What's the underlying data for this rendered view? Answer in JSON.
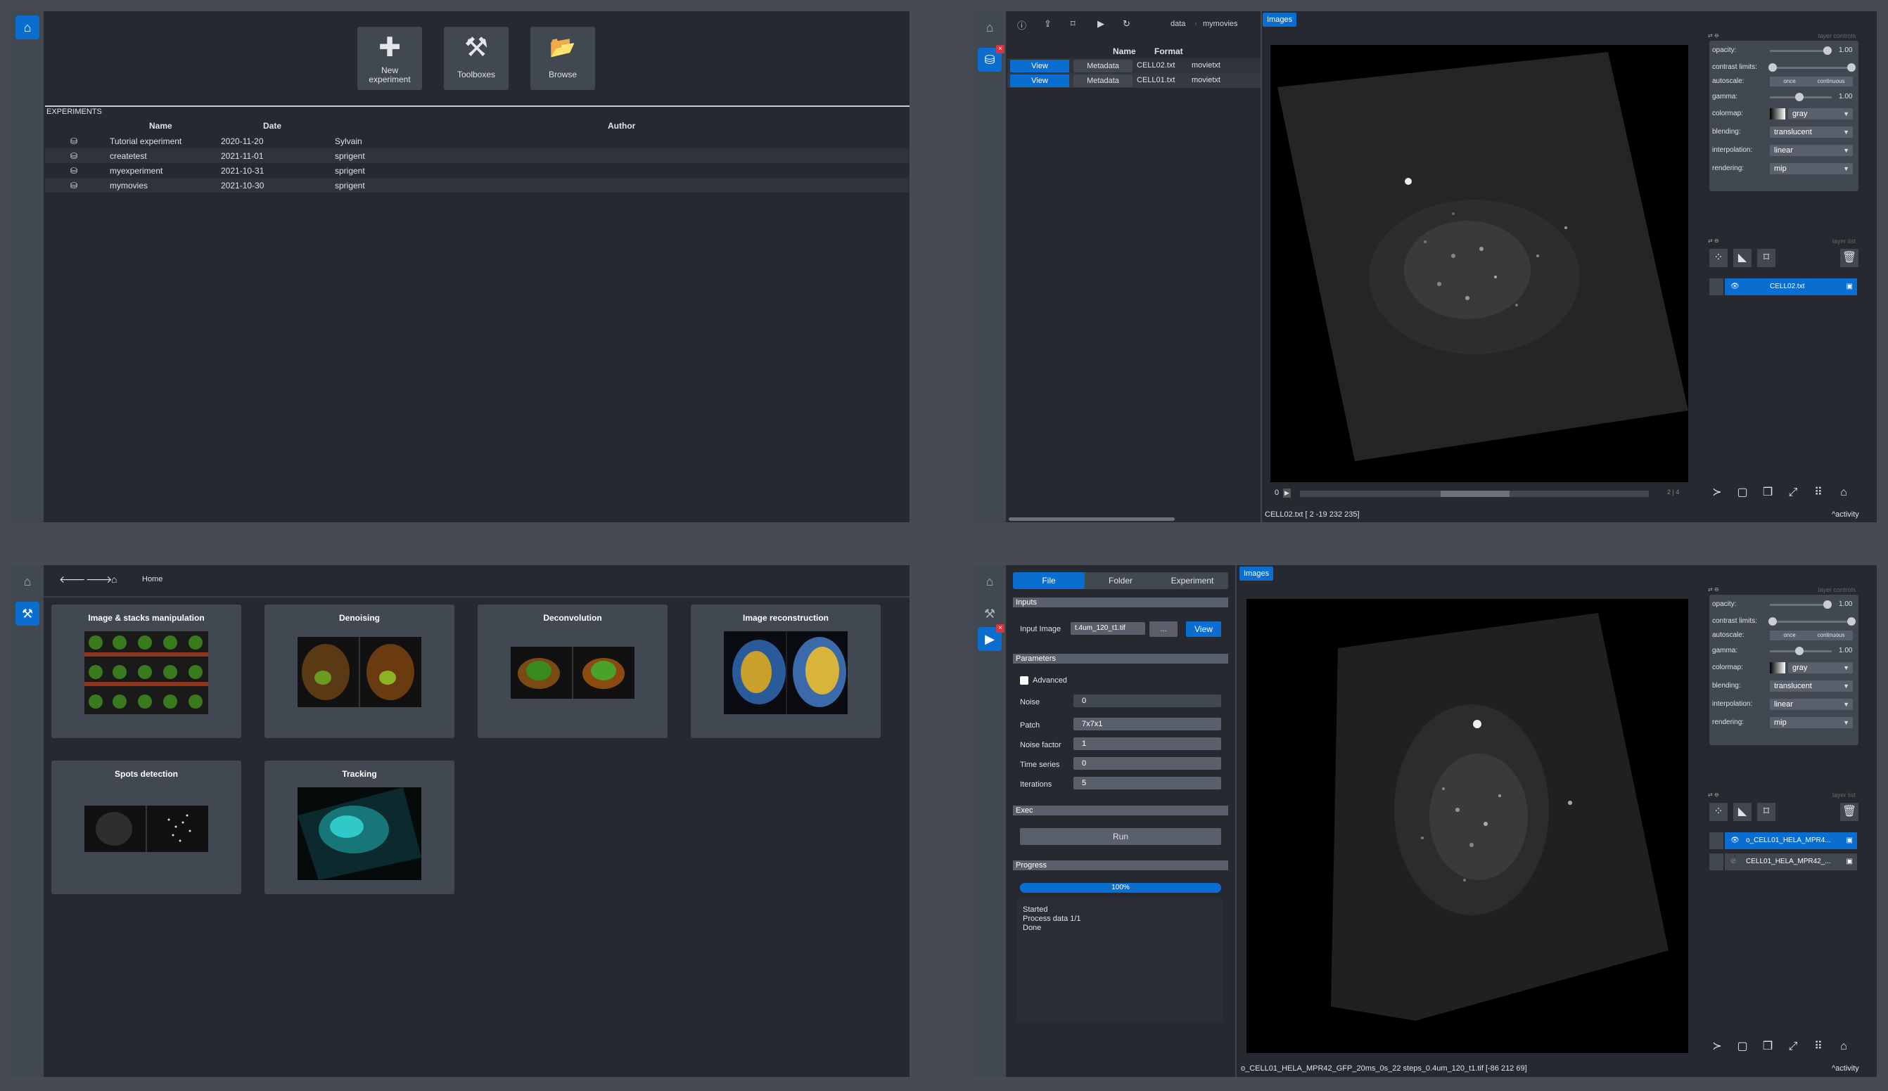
{
  "p1": {
    "tools": [
      {
        "icon": "plus-icon",
        "glyph": "✚",
        "label": "New experiment"
      },
      {
        "icon": "tools-icon",
        "glyph": "⚒",
        "label": "Toolboxes"
      },
      {
        "icon": "folder-open-icon",
        "glyph": "📂",
        "label": "Browse"
      }
    ],
    "section_title": "EXPERIMENTS",
    "columns": [
      "Name",
      "Date",
      "Author"
    ],
    "rows": [
      {
        "name": "Tutorial experiment",
        "date": "2020-11-20",
        "author": "Sylvain"
      },
      {
        "name": "createtest",
        "date": "2021-11-01",
        "author": "sprigent"
      },
      {
        "name": "myexperiment",
        "date": "2021-10-31",
        "author": "sprigent"
      },
      {
        "name": "mymovies",
        "date": "2021-10-30",
        "author": "sprigent"
      }
    ]
  },
  "p2": {
    "breadcrumb": [
      "data",
      "mymovies"
    ],
    "tab": "Images",
    "columns": [
      "Name",
      "Format"
    ],
    "rows": [
      {
        "view": "View",
        "meta": "Metadata",
        "name": "CELL02.txt",
        "format": "movietxt"
      },
      {
        "view": "View",
        "meta": "Metadata",
        "name": "CELL01.txt",
        "format": "movietxt"
      }
    ],
    "status": "CELL02.txt [  2 -19 232 235]",
    "frame": "0",
    "slice": "2 | 4",
    "activity": "activity",
    "layer": "CELL02.txt"
  },
  "p3": {
    "breadcrumb": "Home",
    "cards": [
      "Image & stacks manipulation",
      "Denoising",
      "Deconvolution",
      "Image reconstruction",
      "Spots detection",
      "Tracking"
    ]
  },
  "p4": {
    "tabs": [
      "File",
      "Folder",
      "Experiment"
    ],
    "inputs_title": "Inputs",
    "input_label": "Input Image",
    "input_value": "t.4um_120_t1.tif",
    "browse": "...",
    "view": "View",
    "params_title": "Parameters",
    "advanced": "Advanced",
    "params": [
      {
        "label": "Noise",
        "value": "0"
      },
      {
        "label": "Patch",
        "value": "7x7x1"
      },
      {
        "label": "Noise factor",
        "value": "1"
      },
      {
        "label": "Time series",
        "value": "0"
      },
      {
        "label": "Iterations",
        "value": "5"
      }
    ],
    "exec_title": "Exec",
    "run": "Run",
    "progress_title": "Progress",
    "progress_value": 1.0,
    "progress_text": "100%",
    "log": [
      "Started",
      "Process data 1/1",
      "Done"
    ],
    "tab": "Images",
    "status": "o_CELL01_HELA_MPR42_GFP_20ms_0s_22 steps_0.4um_120_t1.tif [-86 212  69]",
    "activity": "activity",
    "layers": [
      "o_CELL01_HELA_MPR4...",
      "CELL01_HELA_MPR42_..."
    ]
  },
  "controls": {
    "header_left": "⇄ ⊖",
    "header_right": "layer controls",
    "list_right": "layer list",
    "opacity_label": "opacity:",
    "opacity_value": "1.00",
    "opacity": 1.0,
    "contrast_label": "contrast limits:",
    "autoscale_label": "autoscale:",
    "once": "once",
    "continuous": "continuous",
    "gamma_label": "gamma:",
    "gamma_value": "1.00",
    "colormap_label": "colormap:",
    "colormap": "gray",
    "blending_label": "blending:",
    "blending": "translucent",
    "interp_label": "interpolation:",
    "interp": "linear",
    "rendering_label": "rendering:",
    "rendering": "mip"
  },
  "colors": {
    "accent": "#0a6ed1",
    "panel": "#262930",
    "bar": "#414851",
    "background": "#454a55"
  }
}
